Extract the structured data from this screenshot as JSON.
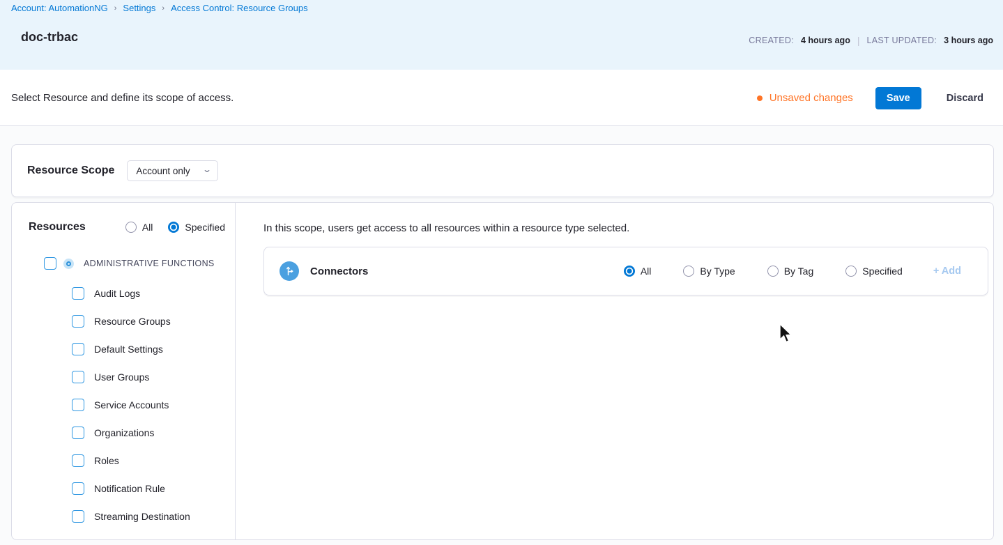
{
  "breadcrumb": {
    "separator": "›",
    "items": [
      {
        "label": "Account: AutomationNG"
      },
      {
        "label": "Settings"
      },
      {
        "label": "Access Control: Resource Groups"
      }
    ]
  },
  "header": {
    "title": "doc-trbac",
    "created_label": "CREATED:",
    "created_value": "4 hours ago",
    "updated_label": "LAST UPDATED:",
    "updated_value": "3 hours ago"
  },
  "toolbar": {
    "description": "Select Resource and define its scope of access.",
    "unsaved_label": "Unsaved changes",
    "save_label": "Save",
    "discard_label": "Discard"
  },
  "resource_scope": {
    "label": "Resource Scope",
    "selected_value": "Account only",
    "chevron_icon": "chevron-down-icon"
  },
  "resources_panel": {
    "title": "Resources",
    "scope_options": [
      {
        "label": "All",
        "selected": false
      },
      {
        "label": "Specified",
        "selected": true
      }
    ],
    "group": {
      "label": "ADMINISTRATIVE FUNCTIONS",
      "checked": false,
      "badge_icon": "group-selected-icon"
    },
    "items": [
      {
        "label": "Audit Logs",
        "checked": false
      },
      {
        "label": "Resource Groups",
        "checked": false
      },
      {
        "label": "Default Settings",
        "checked": false
      },
      {
        "label": "User Groups",
        "checked": false
      },
      {
        "label": "Service Accounts",
        "checked": false
      },
      {
        "label": "Organizations",
        "checked": false
      },
      {
        "label": "Roles",
        "checked": false
      },
      {
        "label": "Notification Rule",
        "checked": false
      },
      {
        "label": "Streaming Destination",
        "checked": false
      }
    ]
  },
  "content": {
    "scope_note": "In this scope, users get access to all resources within a resource type selected.",
    "resource_row": {
      "name": "Connectors",
      "icon": "connectors-branch-icon",
      "options": [
        {
          "label": "All",
          "selected": true
        },
        {
          "label": "By Type",
          "selected": false
        },
        {
          "label": "By Tag",
          "selected": false
        },
        {
          "label": "Specified",
          "selected": false
        }
      ],
      "add_label": "+ Add"
    }
  },
  "colors": {
    "header_bg": "#e9f4fc",
    "link_blue": "#0278d5",
    "primary_blue": "#0278d5",
    "unsaved_orange": "#ff7426",
    "border": "#dcdde8",
    "checkbox_blue": "#2f97e2",
    "add_link_blue": "#a6c9f0",
    "connectors_icon_bg": "#4ba0e0"
  }
}
